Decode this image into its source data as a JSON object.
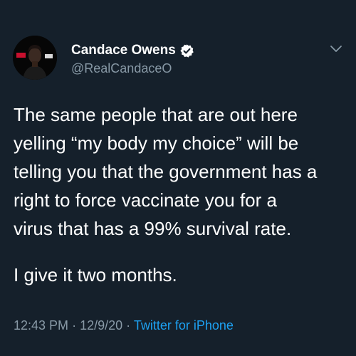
{
  "colors": {
    "background": "#15202b",
    "primary_text": "#ffffff",
    "secondary_text": "#8899a6",
    "accent": "#1da1f2"
  },
  "author": {
    "display_name": "Candace Owens",
    "handle": "@RealCandaceO",
    "verified_icon": "verified-badge-icon",
    "avatar_icon": "profile-photo"
  },
  "tweet": {
    "lines": [
      "The same people that are out here",
      "yelling “my body my choice” will be",
      "telling you that the government has a",
      "right to force vaccinate you for a",
      "virus that has a 99% survival rate."
    ],
    "second_paragraph": "I give it two months."
  },
  "meta": {
    "time": "12:43 PM",
    "separator": "·",
    "date": "12/9/20",
    "source": "Twitter for iPhone"
  },
  "menu_icon": "chevron-down-icon"
}
